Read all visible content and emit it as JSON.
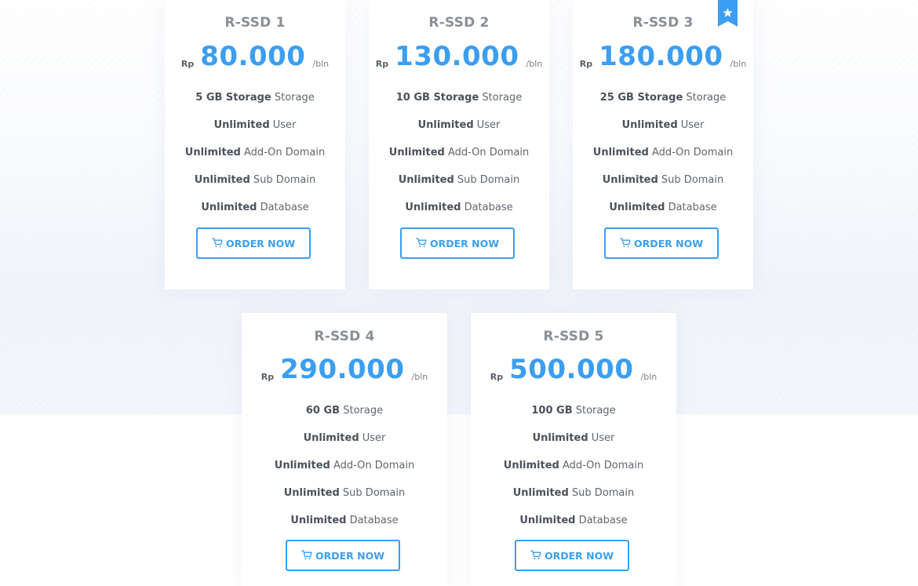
{
  "colors": {
    "accent": "#3c9ef2",
    "plan_name": "#8a8f96",
    "text": "#60666e",
    "ribbon": "#3c9ef2"
  },
  "plans": [
    {
      "name": "R-SSD 1",
      "currency": "Rp",
      "price": "80.000",
      "period": "/bln",
      "featured": false,
      "features": [
        {
          "bold": "5 GB Storage",
          "rest": " Storage"
        },
        {
          "bold": "Unlimited",
          "rest": " User"
        },
        {
          "bold": "Unlimited",
          "rest": " Add-On Domain"
        },
        {
          "bold": "Unlimited",
          "rest": " Sub Domain"
        },
        {
          "bold": "Unlimited",
          "rest": " Database"
        }
      ],
      "button_label": "ORDER NOW",
      "button_icon": "cart-icon"
    },
    {
      "name": "R-SSD 2",
      "currency": "Rp",
      "price": "130.000",
      "period": "/bln",
      "featured": false,
      "features": [
        {
          "bold": "10 GB Storage",
          "rest": " Storage"
        },
        {
          "bold": "Unlimited",
          "rest": " User"
        },
        {
          "bold": "Unlimited",
          "rest": " Add-On Domain"
        },
        {
          "bold": "Unlimited",
          "rest": " Sub Domain"
        },
        {
          "bold": "Unlimited",
          "rest": " Database"
        }
      ],
      "button_label": "ORDER NOW",
      "button_icon": "cart-icon"
    },
    {
      "name": "R-SSD 3",
      "currency": "Rp",
      "price": "180.000",
      "period": "/bln",
      "featured": true,
      "featured_icon": "star-icon",
      "features": [
        {
          "bold": "25 GB Storage",
          "rest": " Storage"
        },
        {
          "bold": "Unlimited",
          "rest": " User"
        },
        {
          "bold": "Unlimited",
          "rest": " Add-On Domain"
        },
        {
          "bold": "Unlimited",
          "rest": " Sub Domain"
        },
        {
          "bold": "Unlimited",
          "rest": " Database"
        }
      ],
      "button_label": "ORDER NOW",
      "button_icon": "cart-icon"
    },
    {
      "name": "R-SSD 4",
      "currency": "Rp",
      "price": "290.000",
      "period": "/bln",
      "featured": false,
      "features": [
        {
          "bold": "60 GB",
          "rest": " Storage"
        },
        {
          "bold": "Unlimited",
          "rest": " User"
        },
        {
          "bold": "Unlimited",
          "rest": " Add-On Domain"
        },
        {
          "bold": "Unlimited",
          "rest": " Sub Domain"
        },
        {
          "bold": "Unlimited",
          "rest": " Database"
        }
      ],
      "button_label": "ORDER NOW",
      "button_icon": "cart-icon"
    },
    {
      "name": "R-SSD 5",
      "currency": "Rp",
      "price": "500.000",
      "period": "/bln",
      "featured": false,
      "features": [
        {
          "bold": "100 GB",
          "rest": " Storage"
        },
        {
          "bold": "Unlimited",
          "rest": " User"
        },
        {
          "bold": "Unlimited",
          "rest": " Add-On Domain"
        },
        {
          "bold": "Unlimited",
          "rest": " Sub Domain"
        },
        {
          "bold": "Unlimited",
          "rest": " Database"
        }
      ],
      "button_label": "ORDER NOW",
      "button_icon": "cart-icon"
    }
  ]
}
